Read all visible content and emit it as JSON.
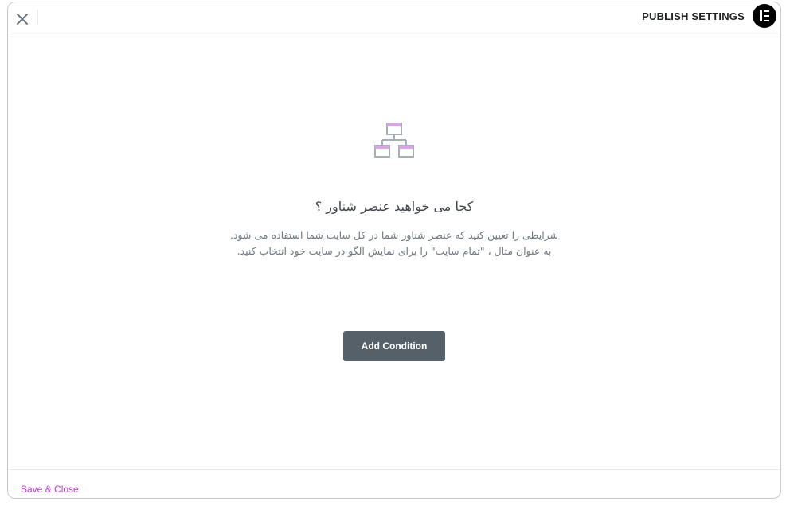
{
  "header": {
    "title": "PUBLISH SETTINGS",
    "close_icon": "close-icon",
    "logo_icon": "elementor-logo-icon"
  },
  "empty_state": {
    "illustration_icon": "sitemap-icon",
    "heading": "کجا می خواهید عنصر شناور ؟",
    "description_line1": "شرایطی را تعیین کنید که عنصر شناور شما در کل سایت شما استفاده می شود.",
    "description_line2": "به عنوان مثال ، \"تمام سایت\" را برای نمایش الگو در سایت خود انتخاب کنید.",
    "add_condition_label": "Add Condition"
  },
  "footer": {
    "save_close_label": "Save & Close"
  },
  "colors": {
    "accent": "#c036d3",
    "button": "#556068",
    "illustration_stroke": "#a4afb7",
    "illustration_fill": "#d8a6e6"
  }
}
